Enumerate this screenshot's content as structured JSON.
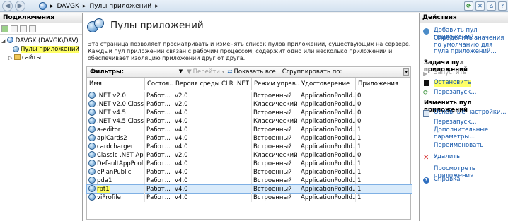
{
  "titlebar": {
    "crumbs": [
      "DAVGK",
      "Пулы приложений"
    ]
  },
  "connections": {
    "header": "Подключения",
    "tree": [
      {
        "label": "DAVGK (DAVGK\\DAV)"
      },
      {
        "label": "Пулы приложений"
      },
      {
        "label": "сайты"
      }
    ]
  },
  "main": {
    "title": "Пулы приложений",
    "description": "Эта страница позволяет просматривать и изменять список пулов приложений, существующих на сервере. Каждый пул приложений связан с рабочим процессом, содержит одно или несколько приложений и обеспечивает изоляцию приложений друг от друга.",
    "filter": {
      "label": "Фильтры:",
      "go": "Перейти",
      "show_all": "Показать все",
      "group_by": "Сгруппировать по:"
    },
    "columns": [
      "Имя",
      "Состоя...",
      "Версия среды CLR .NET",
      "Режим управ...",
      "Удостоверение",
      "Приложения"
    ],
    "rows": [
      {
        "name": ".NET v2.0",
        "state": "Работ...",
        "clr": "v2.0",
        "mode": "Встроенный",
        "identity": "ApplicationPoolId...",
        "apps": "0"
      },
      {
        "name": ".NET v2.0 Classic",
        "state": "Работ...",
        "clr": "v2.0",
        "mode": "Классический",
        "identity": "ApplicationPoolId...",
        "apps": "0"
      },
      {
        "name": ".NET v4.5",
        "state": "Работ...",
        "clr": "v4.0",
        "mode": "Встроенный",
        "identity": "ApplicationPoolId...",
        "apps": "0"
      },
      {
        "name": ".NET v4.5 Classic",
        "state": "Работ...",
        "clr": "v4.0",
        "mode": "Классический",
        "identity": "ApplicationPoolId...",
        "apps": "0"
      },
      {
        "name": "a-editor",
        "state": "Работ...",
        "clr": "v4.0",
        "mode": "Встроенный",
        "identity": "ApplicationPoolId...",
        "apps": "1"
      },
      {
        "name": "apiCards2",
        "state": "Работ...",
        "clr": "v4.0",
        "mode": "Встроенный",
        "identity": "ApplicationPoolId...",
        "apps": "1"
      },
      {
        "name": "cardcharger",
        "state": "Работ...",
        "clr": "v4.0",
        "mode": "Встроенный",
        "identity": "ApplicationPoolId...",
        "apps": "1"
      },
      {
        "name": "Classic .NET Ap...",
        "state": "Работ...",
        "clr": "v2.0",
        "mode": "Классический",
        "identity": "ApplicationPoolId...",
        "apps": "0"
      },
      {
        "name": "DefaultAppPool",
        "state": "Работ...",
        "clr": "v4.0",
        "mode": "Встроенный",
        "identity": "ApplicationPoolId...",
        "apps": "1"
      },
      {
        "name": "ePlanPublic",
        "state": "Работ...",
        "clr": "v4.0",
        "mode": "Встроенный",
        "identity": "ApplicationPoolId...",
        "apps": "1"
      },
      {
        "name": "pda1",
        "state": "Работ...",
        "clr": "v4.0",
        "mode": "Встроенный",
        "identity": "ApplicationPoolId...",
        "apps": "1"
      },
      {
        "name": "rpt1",
        "state": "Работ...",
        "clr": "v4.0",
        "mode": "Встроенный",
        "identity": "ApplicationPoolId...",
        "apps": "1"
      },
      {
        "name": "viProfile",
        "state": "Работ...",
        "clr": "v4.0",
        "mode": "Встроенный",
        "identity": "ApplicationPoolId...",
        "apps": "1"
      }
    ]
  },
  "actions": {
    "header": "Действия",
    "add_pool": "Добавить пул приложений...",
    "set_defaults": "Определить значения по умолчанию для пула приложений...",
    "tasks_header": "Задачи пул приложений",
    "start": "Запустить",
    "stop": "Остановить",
    "recycle": "Перезапуск...",
    "edit_header": "Изменить пул приложений",
    "basic_settings": "Основные настройки...",
    "recycling": "Перезапуск...",
    "advanced": "Дополнительные параметры...",
    "rename": "Переименовать",
    "remove": "Удалить",
    "view_apps": "Просмотреть приложения",
    "help": "Справка"
  }
}
